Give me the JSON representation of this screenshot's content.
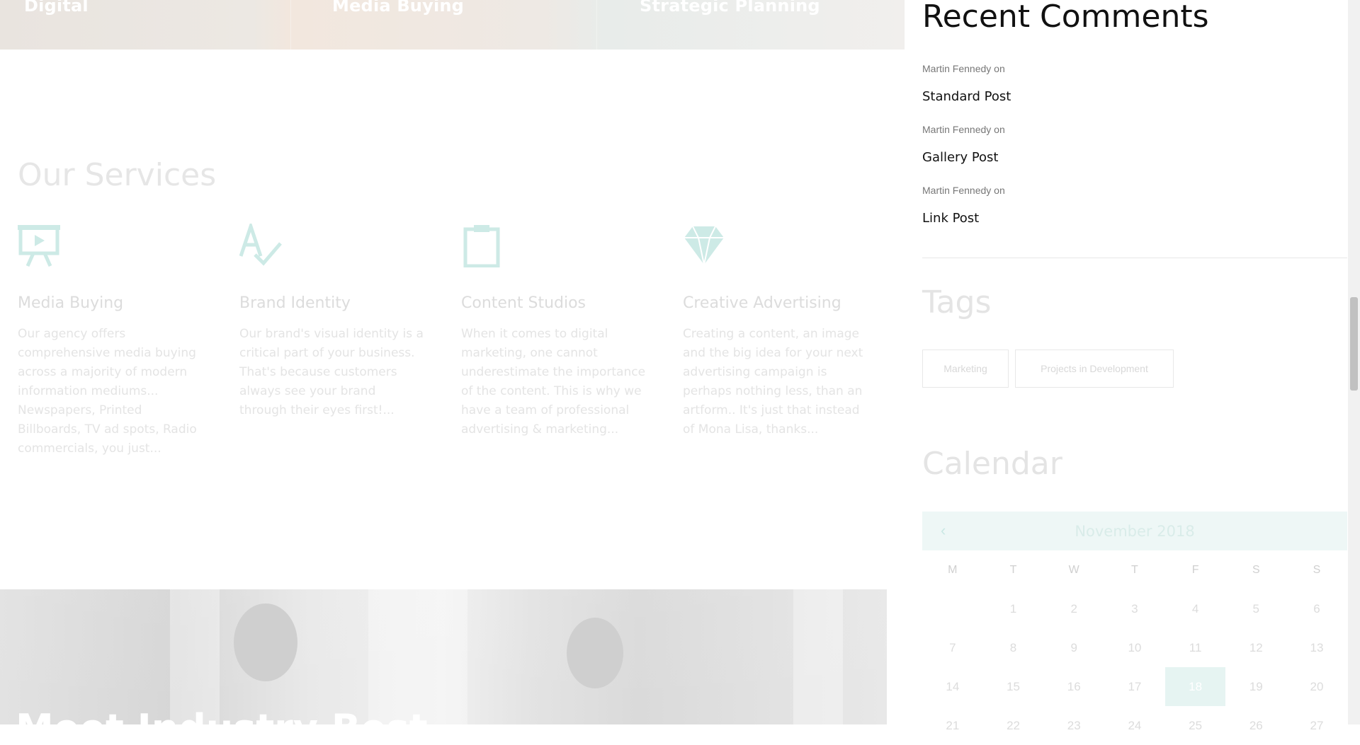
{
  "banner": {
    "items": [
      "Digital",
      "Media Buying",
      "Strategic Planning"
    ]
  },
  "services": {
    "title": "Our Services",
    "items": [
      {
        "icon": "presentation-icon",
        "title": "Media Buying",
        "text": "Our agency offers comprehensive media buying across a majority of modern information mediums... Newspapers, Printed Billboards, TV ad spots, Radio commercials, you just..."
      },
      {
        "icon": "spellcheck-icon",
        "title": "Brand Identity",
        "text": "Our brand's visual identity is a critical part of your business. That's because customers always see your brand through their eyes first!..."
      },
      {
        "icon": "clipboard-icon",
        "title": "Content Studios",
        "text": "When it comes to digital marketing, one cannot underestimate the importance of the content. This is why we have a team of professional advertising & marketing..."
      },
      {
        "icon": "diamond-icon",
        "title": "Creative Advertising",
        "text": "Creating a content, an image and the big idea for your next advertising campaign is perhaps nothing less, than an artform.. It's just that instead of Mona Lisa, thanks..."
      }
    ],
    "accent": "#cdeae6"
  },
  "photo_section": {
    "title": "Meet Industry Best"
  },
  "sidebar": {
    "recent_comments": {
      "title": "Recent Comments",
      "items": [
        {
          "author": "Martin Fennedy",
          "on": "on",
          "post": "Standard Post"
        },
        {
          "author": "Martin Fennedy",
          "on": "on",
          "post": "Gallery Post"
        },
        {
          "author": "Martin Fennedy",
          "on": "on",
          "post": "Link Post"
        }
      ]
    },
    "tags": {
      "title": "Tags",
      "items": [
        "Marketing",
        "Projects in Development"
      ]
    },
    "calendar": {
      "title": "Calendar",
      "prev": "‹",
      "month": "November 2018",
      "dow": [
        "M",
        "T",
        "W",
        "T",
        "F",
        "S",
        "S"
      ],
      "weeks": [
        [
          "",
          "1",
          "2",
          "3",
          "4",
          "5",
          "6"
        ],
        [
          "7",
          "8",
          "9",
          "10",
          "11",
          "12",
          "13"
        ],
        [
          "14",
          "15",
          "16",
          "17",
          "18",
          "19",
          "20"
        ],
        [
          "21",
          "22",
          "23",
          "24",
          "25",
          "26",
          "27"
        ]
      ],
      "today": "18"
    }
  }
}
